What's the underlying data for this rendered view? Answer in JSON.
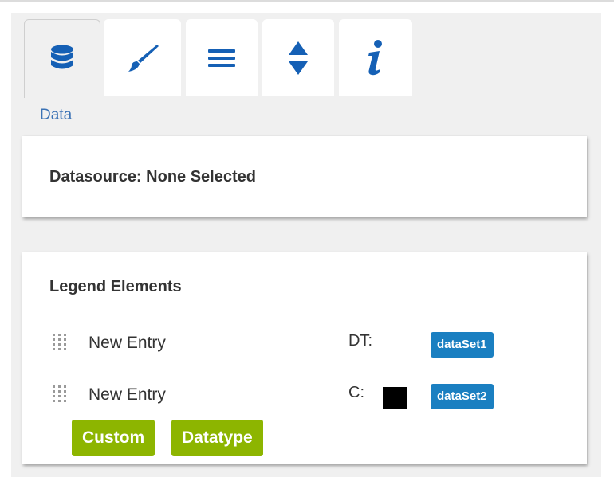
{
  "tabs": [
    {
      "id": "data",
      "icon": "database-icon",
      "active": true
    },
    {
      "id": "style",
      "icon": "paintbrush-icon",
      "active": false
    },
    {
      "id": "legend",
      "icon": "list-icon",
      "active": false
    },
    {
      "id": "sort",
      "icon": "sort-arrows-icon",
      "active": false
    },
    {
      "id": "info",
      "icon": "info-icon",
      "active": false
    }
  ],
  "section_label": "Data",
  "datasource": {
    "text": "Datasource: None Selected"
  },
  "legend": {
    "title": "Legend Elements",
    "entries": [
      {
        "label": "New Entry",
        "type": "DT:",
        "dataset": "dataSet1",
        "swatch": null
      },
      {
        "label": "New Entry",
        "type": "C:",
        "dataset": "dataSet2",
        "swatch": "#000000"
      }
    ],
    "buttons": {
      "custom": "Custom",
      "datatype": "Datatype"
    }
  },
  "colors": {
    "accent": "#1a7fc1",
    "button_green": "#8db500",
    "link_blue": "#3b72b5"
  }
}
